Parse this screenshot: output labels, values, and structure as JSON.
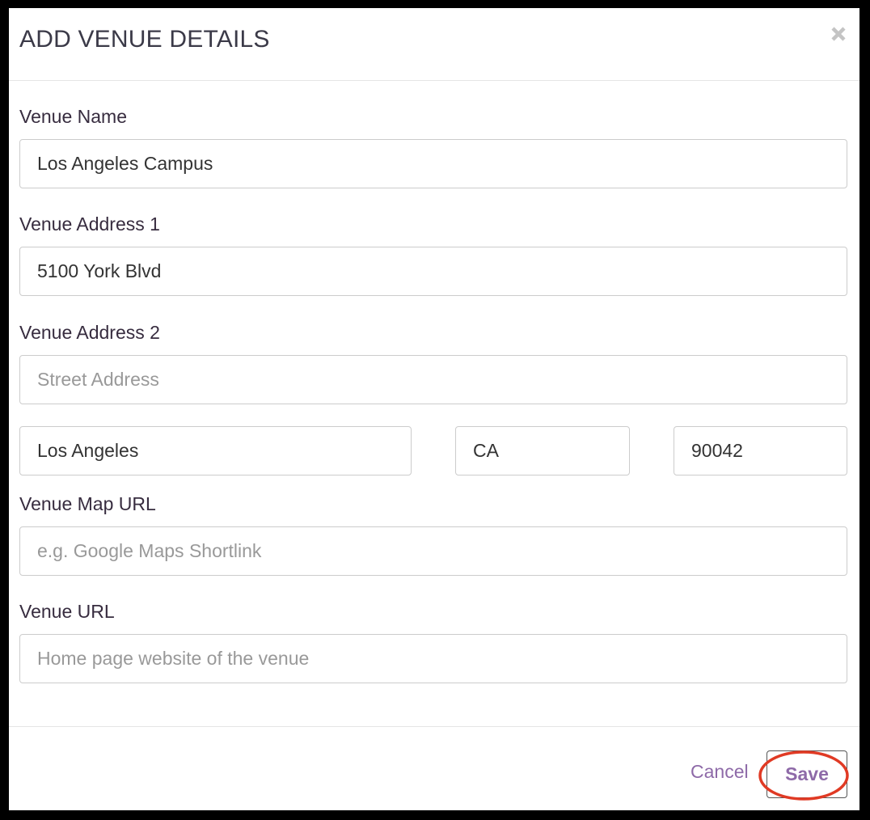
{
  "modal": {
    "title": "ADD VENUE DETAILS",
    "close_icon": "close-icon"
  },
  "form": {
    "venue_name": {
      "label": "Venue Name",
      "value": "Los Angeles Campus",
      "placeholder": ""
    },
    "address1": {
      "label": "Venue Address 1",
      "value": "5100 York Blvd",
      "placeholder": ""
    },
    "address2": {
      "label": "Venue Address 2",
      "value": "",
      "placeholder": "Street Address"
    },
    "city": {
      "value": "Los Angeles"
    },
    "state": {
      "value": "CA"
    },
    "zip": {
      "value": "90042"
    },
    "map_url": {
      "label": "Venue Map URL",
      "value": "",
      "placeholder": "e.g. Google Maps Shortlink"
    },
    "venue_url": {
      "label": "Venue URL",
      "value": "",
      "placeholder": "Home page website of the venue"
    }
  },
  "footer": {
    "cancel_label": "Cancel",
    "save_label": "Save"
  },
  "colors": {
    "backdrop": "#000000",
    "accent_purple": "#8e6aa8",
    "label_text": "#372c3f",
    "annotation_red": "#e03a24"
  }
}
